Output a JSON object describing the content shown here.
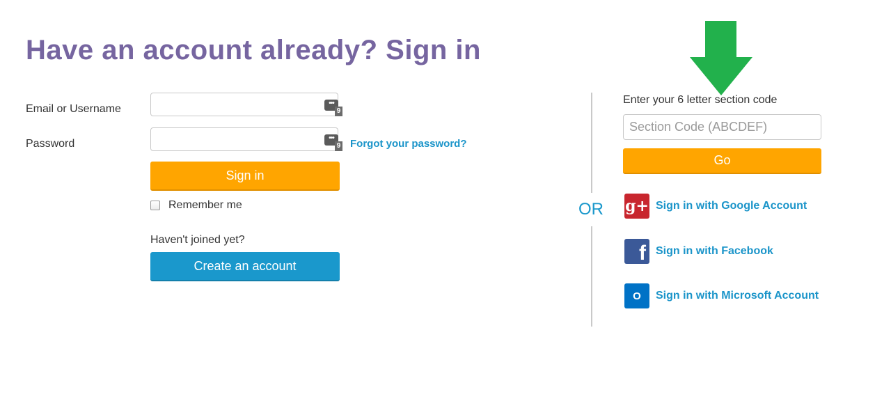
{
  "heading": "Have an account already? Sign in",
  "login_form": {
    "email_label": "Email or Username",
    "email_value": "",
    "password_label": "Password",
    "password_value": "",
    "password_manager_badge": "9",
    "password_manager_dots": "•••",
    "forgot_password": "Forgot your password?",
    "sign_in_button": "Sign in",
    "remember_me": "Remember me",
    "remember_checked": false,
    "not_joined_text": "Haven't joined yet?",
    "create_account_button": "Create an account"
  },
  "or_text": "OR",
  "section": {
    "label": "Enter your 6 letter section code",
    "placeholder": "Section Code (ABCDEF)",
    "go_button": "Go"
  },
  "social": {
    "google": {
      "label": "Sign in with Google Account",
      "icon": "google-plus-icon",
      "glyph": "g+"
    },
    "facebook": {
      "label": "Sign in with Facebook",
      "icon": "facebook-icon",
      "glyph": "f"
    },
    "microsoft": {
      "label": "Sign in with Microsoft Account",
      "icon": "outlook-icon",
      "glyph": "O"
    }
  },
  "colors": {
    "heading": "#7665a0",
    "orange_button": "#ffa500",
    "blue_button": "#1a98cc",
    "link": "#1a94c9",
    "arrow": "#22b14c"
  }
}
